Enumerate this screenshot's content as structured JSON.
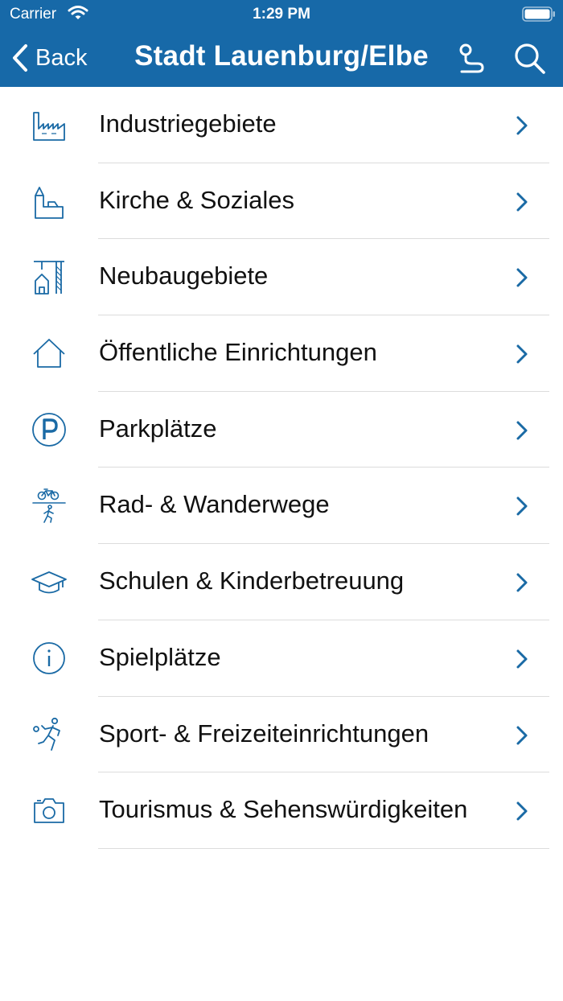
{
  "status_bar": {
    "carrier": "Carrier",
    "time": "1:29 PM"
  },
  "nav": {
    "back_label": "Back",
    "title": "Stadt Lauenburg/Elbe"
  },
  "colors": {
    "accent": "#1769a8",
    "icon_stroke": "#1a6aa5",
    "divider": "#dcdcdc"
  },
  "categories": [
    {
      "label": "Industriegebiete",
      "icon": "factory-icon"
    },
    {
      "label": "Kirche & Soziales",
      "icon": "church-icon"
    },
    {
      "label": "Neubaugebiete",
      "icon": "crane-house-icon"
    },
    {
      "label": "Öffentliche Einrichtungen",
      "icon": "house-icon"
    },
    {
      "label": "Parkplätze",
      "icon": "parking-icon"
    },
    {
      "label": "Rad- & Wanderwege",
      "icon": "bike-hike-icon"
    },
    {
      "label": "Schulen & Kinderbetreuung",
      "icon": "graduation-cap-icon"
    },
    {
      "label": "Spielplätze",
      "icon": "info-icon"
    },
    {
      "label": "Sport- & Freizeiteinrichtungen",
      "icon": "runner-icon"
    },
    {
      "label": "Tourismus & Sehenswürdigkeiten",
      "icon": "camera-icon"
    }
  ]
}
